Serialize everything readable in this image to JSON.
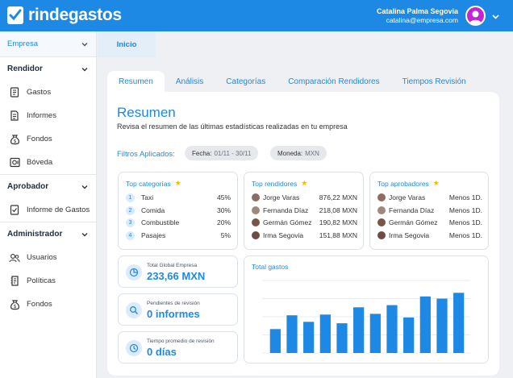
{
  "app": {
    "brand": "rindegastos"
  },
  "user": {
    "name": "Catalina Palma Segovia",
    "email": "catalina@empresa.com"
  },
  "sidebar": {
    "company": "Empresa",
    "sections": [
      {
        "title": "Rendidor",
        "items": [
          "Gastos",
          "Informes",
          "Fondos",
          "Bóveda"
        ]
      },
      {
        "title": "Aprobador",
        "items": [
          "Informe de Gastos"
        ]
      },
      {
        "title": "Administrador",
        "items": [
          "Usuarios",
          "Políticas",
          "Fondos"
        ]
      }
    ]
  },
  "main_tab": "Inicio",
  "subtabs": [
    "Resumen",
    "Análisis",
    "Categorías",
    "Comparación Rendidores",
    "Tiempos Revisión"
  ],
  "summary": {
    "title": "Resumen",
    "subtitle": "Revisa el resumen de las últimas estadísticas realizadas en tu empresa",
    "filters_label": "Filtros Aplicados:",
    "filters": [
      {
        "label": "Fecha:",
        "value": "01/11 - 30/11"
      },
      {
        "label": "Moneda:",
        "value": "MXN"
      }
    ]
  },
  "top_categorias": {
    "title": "Top categorías",
    "rows": [
      {
        "rank": "1",
        "name": "Taxi",
        "value": "45%"
      },
      {
        "rank": "2",
        "name": "Comida",
        "value": "30%"
      },
      {
        "rank": "3",
        "name": "Combustible",
        "value": "20%"
      },
      {
        "rank": "4",
        "name": "Pasajes",
        "value": "5%"
      }
    ]
  },
  "top_rendidores": {
    "title": "Top rendidores",
    "rows": [
      {
        "name": "Jorge Varas",
        "value": "876,22 MXN"
      },
      {
        "name": "Fernanda Díaz",
        "value": "218,08 MXN"
      },
      {
        "name": "Germán Gómez",
        "value": "190,82 MXN"
      },
      {
        "name": "Irma Segovia",
        "value": "151,88 MXN"
      }
    ]
  },
  "top_aprobadores": {
    "title": "Top aprobadores",
    "rows": [
      {
        "name": "Jorge Varas",
        "value": "Menos 1D."
      },
      {
        "name": "Fernanda Díaz",
        "value": "Menos 1D."
      },
      {
        "name": "Germán Gómez",
        "value": "Menos 1D."
      },
      {
        "name": "Irma Segovia",
        "value": "Menos 1D."
      }
    ]
  },
  "stats": [
    {
      "label": "Total Global Empresa",
      "value": "233,66 MXN",
      "icon": "pie-chart-icon"
    },
    {
      "label": "Pendientes de revisión",
      "value": "0 informes",
      "icon": "magnifier-icon"
    },
    {
      "label": "Tiempo promedio de revisión",
      "value": "0 días",
      "icon": "clock-icon"
    }
  ],
  "chart_title": "Total gastos",
  "chart_data": {
    "type": "bar",
    "categories": [
      "",
      "",
      "",
      "",
      "",
      "",
      "",
      "",
      "",
      "",
      "",
      ""
    ],
    "values": [
      33,
      52,
      43,
      53,
      41,
      63,
      54,
      66,
      49,
      78,
      75,
      83
    ],
    "ylim": [
      0,
      100
    ],
    "color": "#1e88e5"
  },
  "colors": {
    "accent": "#1e88e5",
    "star": "#f5b800",
    "avatar": "#c026d3"
  }
}
